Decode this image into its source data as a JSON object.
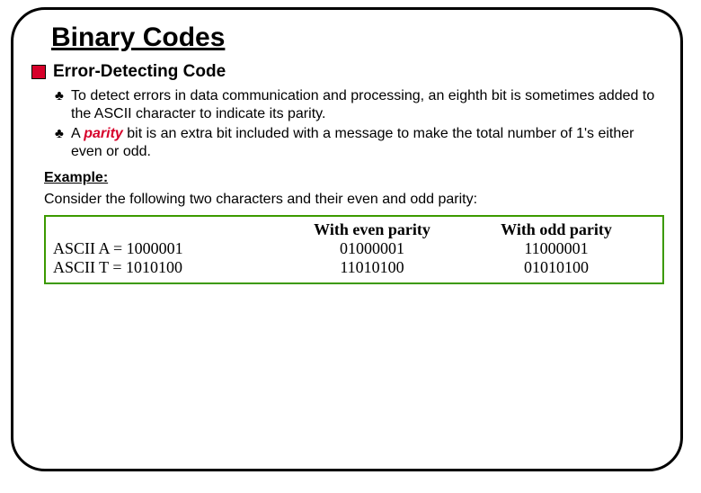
{
  "title": "Binary Codes",
  "subhead": "Error-Detecting Code",
  "bullets": [
    {
      "pre": "To detect errors in data communication and processing, an eighth bit is sometimes added to the ASCII character to indicate its parity."
    },
    {
      "pre": "A ",
      "emph": "parity",
      "post": " bit is an extra bit included with a message to make the total number of 1's either even or odd."
    }
  ],
  "example_label": "Example:",
  "example_intro": "Consider the following two characters and their even and odd parity:",
  "table": {
    "headers": [
      "",
      "With even parity",
      "With odd parity"
    ],
    "rows": [
      [
        "ASCII A = 1000001",
        "01000001",
        "11000001"
      ],
      [
        "ASCII T = 1010100",
        "11010100",
        "01010100"
      ]
    ]
  }
}
